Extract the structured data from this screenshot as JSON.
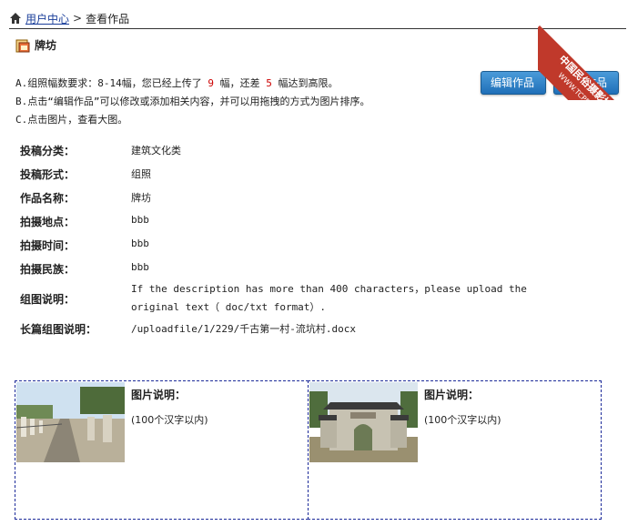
{
  "breadcrumb": {
    "home_link": "用户中心",
    "separator": ">",
    "current": "查看作品"
  },
  "title": "牌坊",
  "notes": {
    "line_a_prefix": "A.组照幅数要求：8-14幅，您已经上传了",
    "uploaded_count": "9",
    "line_a_mid": "幅，还差",
    "remaining_count": "5",
    "line_a_suffix": "幅达到高限。",
    "line_b": "B.点击“编辑作品”可以修改或添加相关内容，并可以用拖拽的方式为图片排序。",
    "line_c": "C.点击图片，查看大图。"
  },
  "buttons": {
    "edit": "编辑作品",
    "upload": "上传作品"
  },
  "info": {
    "category_label": "投稿分类：",
    "category_value": "建筑文化类",
    "form_label": "投稿形式：",
    "form_value": "组照",
    "name_label": "作品名称：",
    "name_value": "牌坊",
    "location_label": "拍摄地点：",
    "location_value": "bbb",
    "time_label": "拍摄时间：",
    "time_value": "bbb",
    "ethnic_label": "拍摄民族：",
    "ethnic_value": "bbb",
    "desc_label": "组图说明：",
    "desc_value": "If the description has more than 400 characters，please upload the original text（ doc/txt format）.",
    "long_desc_label": "长篇组图说明：",
    "long_desc_value": "/uploadfile/1/229/千古第一村-流坑村.docx"
  },
  "cards": [
    {
      "title": "图片说明：",
      "hint": "(100个汉字以内)"
    },
    {
      "title": "图片说明：",
      "hint": "(100个汉字以内)"
    }
  ],
  "ribbon": {
    "main": "中国民俗摄影协会",
    "sub": "WWW.TCPPA.CN"
  },
  "colors": {
    "accent_blue": "#1f6fb8",
    "ribbon_red": "#c0392b",
    "highlight_red": "#cc0000"
  }
}
